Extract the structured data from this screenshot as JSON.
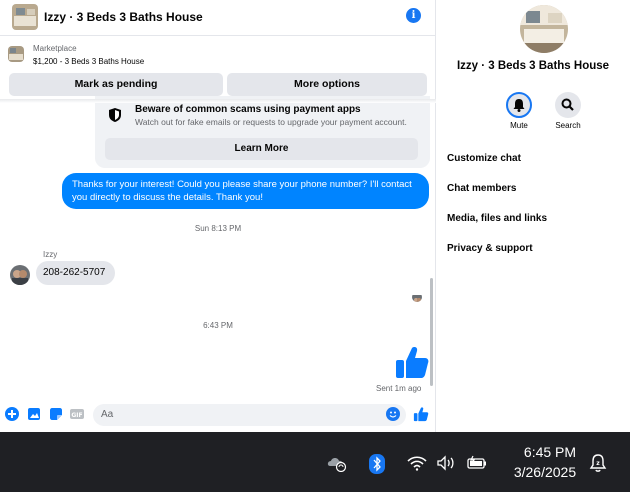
{
  "header": {
    "title": "Izzy · 3 Beds 3 Baths House"
  },
  "listing": {
    "source": "Marketplace",
    "summary": "$1,200 - 3 Beds 3 Baths House"
  },
  "actions": {
    "pending_label": "Mark as pending",
    "more_label": "More options"
  },
  "scam_notice": {
    "title": "Beware of common scams using payment apps",
    "desc": "Watch out for fake emails or requests to upgrade your payment account.",
    "learn_more": "Learn More"
  },
  "messages": {
    "outgoing_text": "Thanks for your interest! Could you please share your phone number? I'll contact you directly to discuss the details. Thank you!",
    "time1": "Sun 8:13 PM",
    "sender_name": "Izzy",
    "incoming_text": "208-262-5707",
    "time2": "6:43 PM",
    "sent_status": "Sent 1m ago"
  },
  "composer": {
    "placeholder": "Aa"
  },
  "side_panel": {
    "name": "Izzy · 3 Beds 3 Baths House",
    "mute_label": "Mute",
    "search_label": "Search",
    "menu": [
      "Customize chat",
      "Chat members",
      "Media, files and links",
      "Privacy & support"
    ]
  },
  "taskbar": {
    "time": "6:45 PM",
    "date": "3/26/2025"
  },
  "colors": {
    "accent": "#1877f2",
    "bubble": "#0084ff",
    "taskbar": "#1f2024"
  }
}
